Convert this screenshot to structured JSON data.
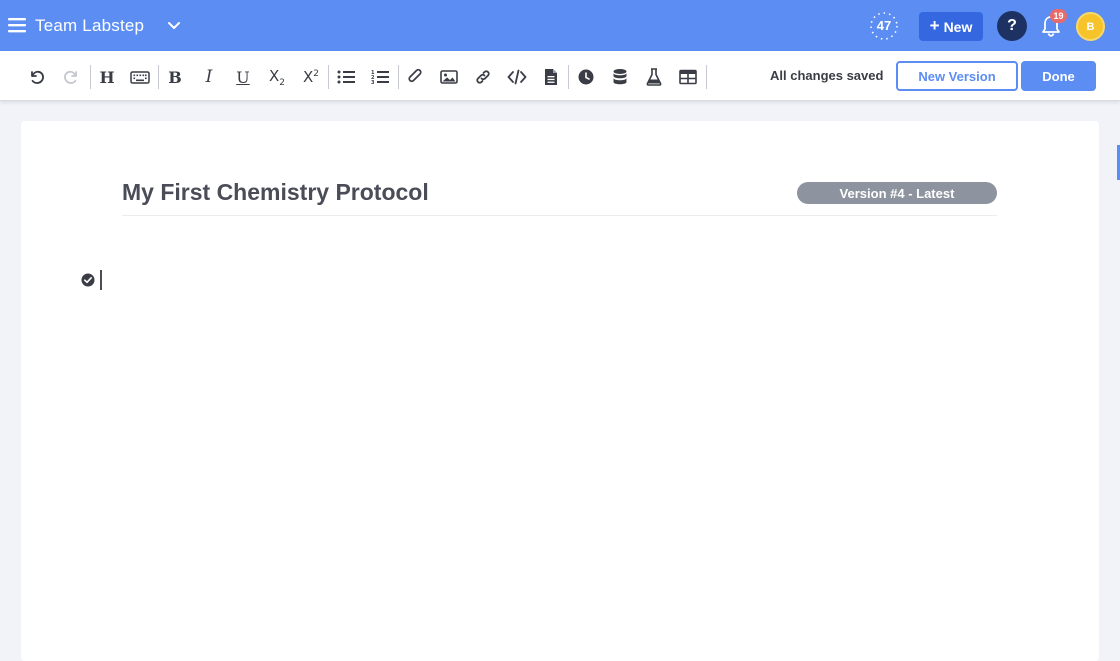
{
  "topbar": {
    "team_name": "Team Labstep",
    "timer_value": "47",
    "new_label": "New",
    "help_label": "?",
    "notification_count": "19",
    "avatar_initial": "B"
  },
  "toolbar": {
    "save_status": "All changes saved",
    "new_version_label": "New Version",
    "done_label": "Done",
    "tools": [
      "undo",
      "redo",
      "heading",
      "keyboard",
      "bold",
      "italic",
      "underline",
      "subscript",
      "superscript",
      "bullet-list",
      "numbered-list",
      "attachment",
      "image",
      "link",
      "code",
      "file",
      "timer",
      "database",
      "flask",
      "table"
    ]
  },
  "document": {
    "title": "My First Chemistry Protocol",
    "version_badge": "Version #4 - Latest"
  },
  "colors": {
    "brand": "#5b8df3",
    "brand_dark": "#3568e0",
    "help": "#1d3162",
    "badge": "#e86a6a",
    "avatar": "#f6c32a",
    "version_badge": "#8d939f"
  }
}
